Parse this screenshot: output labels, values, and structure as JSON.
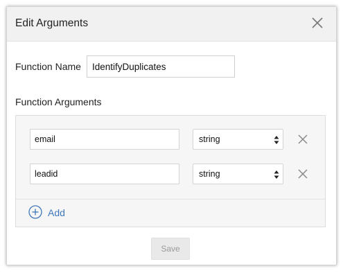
{
  "dialog": {
    "title": "Edit Arguments",
    "close_icon": "close-icon"
  },
  "function_name": {
    "label": "Function Name",
    "value": "IdentifyDuplicates"
  },
  "arguments": {
    "label": "Function Arguments",
    "rows": [
      {
        "name": "email",
        "type": "string"
      },
      {
        "name": "leadid",
        "type": "string"
      }
    ],
    "add_label": "Add",
    "add_icon": "plus-circle-icon",
    "remove_icon": "close-icon",
    "select_icon": "select-arrows-icon"
  },
  "footer": {
    "save_label": "Save"
  },
  "colors": {
    "header_bg": "#f1f1f1",
    "panel_bg": "#f6f6f6",
    "accent": "#3f78b8",
    "disabled_button_bg": "#e9e9e9",
    "disabled_button_text": "#9a9a9a"
  }
}
